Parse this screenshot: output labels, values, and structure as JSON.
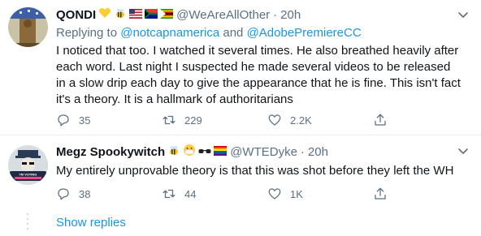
{
  "tweet1": {
    "name": "QONDI",
    "handle": "@WeAreAllOther",
    "dot": "·",
    "time": "20h",
    "replying_prefix": "Replying to",
    "replying_to_1": "@notcapnamerica",
    "replying_and": "and",
    "replying_to_2": "@AdobePremiereCC",
    "text": "I noticed that too. I watched it several times. He also breathed heavily after each word. Last night I suspected he made several videos to be released in a slow drip each day to give the appearance that he is fine. This isn't fact it's a theory. It is a hallmark of authoritarians",
    "replies": "35",
    "retweets": "229",
    "likes": "2.2K"
  },
  "tweet2": {
    "name": "Megz Spookywitch",
    "handle": "@WTEDyke",
    "dot": "·",
    "time": "20h",
    "text": "My entirely unprovable theory is that this was shot before they left the WH",
    "replies": "38",
    "retweets": "44",
    "likes": "1K",
    "avatar_badge": "I'M VOTING"
  },
  "show_replies": "Show replies",
  "colors": {
    "link": "#1b95e0",
    "secondary": "#5b7083",
    "text": "#0f1419",
    "divider": "#e6ecf0"
  },
  "icons": [
    "reply-icon",
    "retweet-icon",
    "like-icon",
    "share-icon",
    "caret-down-icon"
  ]
}
